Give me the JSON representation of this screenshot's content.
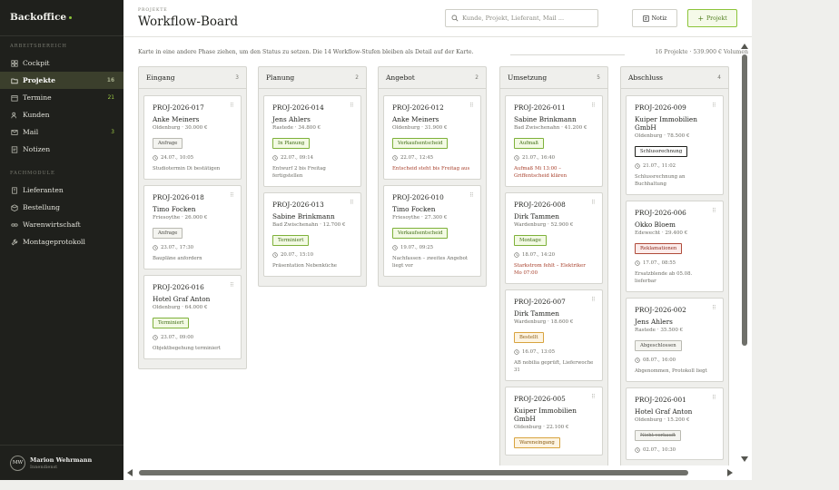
{
  "brand": "Backoffice",
  "sidebar": {
    "section_work": "ARBEITSBEREICH",
    "section_modules": "FACHMODULE",
    "work_items": [
      {
        "label": "Cockpit",
        "icon": "grid-icon",
        "badge": ""
      },
      {
        "label": "Projekte",
        "icon": "folder-icon",
        "badge": "16"
      },
      {
        "label": "Termine",
        "icon": "calendar-icon",
        "badge": "21"
      },
      {
        "label": "Kunden",
        "icon": "users-icon",
        "badge": ""
      },
      {
        "label": "Mail",
        "icon": "mail-icon",
        "badge": "3"
      },
      {
        "label": "Notizen",
        "icon": "note-icon",
        "badge": ""
      }
    ],
    "module_items": [
      {
        "label": "Lieferanten",
        "icon": "building-icon"
      },
      {
        "label": "Bestellung",
        "icon": "package-icon"
      },
      {
        "label": "Warenwirtschaft",
        "icon": "link-icon"
      },
      {
        "label": "Montageprotokoll",
        "icon": "wrench-icon"
      }
    ]
  },
  "user": {
    "initials": "MW",
    "name": "Marion Wehrmann",
    "role": "Innendienst"
  },
  "header": {
    "eyebrow": "PROJEKTE",
    "title": "Workflow-Board",
    "search_placeholder": "Kunde, Projekt, Lieferant, Mail ...",
    "note_button": "Notiz",
    "project_button": "Projekt"
  },
  "hint": "Karte in eine andere Phase ziehen, um den Status zu setzen. Die 14 Workflow-Stufen bleiben als Detail auf der Karte.",
  "stats": "16 Projekte · 539.900 € Volumen",
  "columns": [
    {
      "title": "Eingang",
      "count": "3",
      "cards": [
        {
          "id": "PROJ-2026-017",
          "name": "Anke Meiners",
          "meta": "Oldenburg · 30.000 €",
          "tag": "Anfrage",
          "tag_style": "gray",
          "time": "24.07., 10:05",
          "note": "Studiotermin Di bestätigen",
          "alert": false
        },
        {
          "id": "PROJ-2026-018",
          "name": "Timo Focken",
          "meta": "Friesoythe · 26.000 €",
          "tag": "Anfrage",
          "tag_style": "gray",
          "time": "23.07., 17:30",
          "note": "Baupläne anfordern",
          "alert": false
        },
        {
          "id": "PROJ-2026-016",
          "name": "Hotel Graf Anton",
          "meta": "Oldenburg · 64.000 €",
          "tag": "Terminiert",
          "tag_style": "green",
          "time": "23.07., 09:00",
          "note": "Objektbegehung terminiert",
          "alert": false
        }
      ]
    },
    {
      "title": "Planung",
      "count": "2",
      "cards": [
        {
          "id": "PROJ-2026-014",
          "name": "Jens Ahlers",
          "meta": "Rastede · 34.800 €",
          "tag": "In Planung",
          "tag_style": "green",
          "time": "22.07., 09:14",
          "note": "Entwurf 2 bis Freitag fertigstellen",
          "alert": false
        },
        {
          "id": "PROJ-2026-013",
          "name": "Sabine Brinkmann",
          "meta": "Bad Zwischenahn · 12.700 €",
          "tag": "Terminiert",
          "tag_style": "green",
          "time": "20.07., 15:10",
          "note": "Präsentation Nebenküche",
          "alert": false
        }
      ]
    },
    {
      "title": "Angebot",
      "count": "2",
      "cards": [
        {
          "id": "PROJ-2026-012",
          "name": "Anke Meiners",
          "meta": "Oldenburg · 31.900 €",
          "tag": "Verkaufsentscheid",
          "tag_style": "green",
          "time": "22.07., 12:45",
          "note": "Entscheid steht bis Freitag aus",
          "alert": true
        },
        {
          "id": "PROJ-2026-010",
          "name": "Timo Focken",
          "meta": "Friesoythe · 27.300 €",
          "tag": "Verkaufsentscheid",
          "tag_style": "green",
          "time": "19.07., 09:25",
          "note": "Nachfassen – zweites Angebot liegt vor",
          "alert": false
        }
      ]
    },
    {
      "title": "Umsetzung",
      "count": "5",
      "cards": [
        {
          "id": "PROJ-2026-011",
          "name": "Sabine Brinkmann",
          "meta": "Bad Zwischenahn · 41.200 €",
          "tag": "Aufmaß",
          "tag_style": "green",
          "time": "21.07., 16:40",
          "note": "Aufmaß Mi 13:00 – Griffentscheid klären",
          "alert": true
        },
        {
          "id": "PROJ-2026-008",
          "name": "Dirk Tammen",
          "meta": "Wardenburg · 52.900 €",
          "tag": "Montage",
          "tag_style": "green",
          "time": "18.07., 14:20",
          "note": "Starkstrom fehlt – Elektriker Mo 07:00",
          "alert": true
        },
        {
          "id": "PROJ-2026-007",
          "name": "Dirk Tammen",
          "meta": "Wardenburg · 18.600 €",
          "tag": "Bestellt",
          "tag_style": "amber",
          "time": "16.07., 13:05",
          "note": "AB nobilia geprüft, Lieferwoche 31",
          "alert": false
        },
        {
          "id": "PROJ-2026-005",
          "name": "Kuiper Immobilien GmbH",
          "meta": "Oldenburg · 22.100 €",
          "tag": "Wareneingang",
          "tag_style": "amber",
          "time": "",
          "note": "",
          "alert": false
        }
      ]
    },
    {
      "title": "Abschluss",
      "count": "4",
      "cards": [
        {
          "id": "PROJ-2026-009",
          "name": "Kuiper Immobilien GmbH",
          "meta": "Oldenburg · 78.500 €",
          "tag": "Schlussrechnung",
          "tag_style": "dark",
          "time": "21.07., 11:02",
          "note": "Schlussrechnung an Buchhaltung",
          "alert": false
        },
        {
          "id": "PROJ-2026-006",
          "name": "Okko Bloem",
          "meta": "Edewecht · 29.400 €",
          "tag": "Reklamationen",
          "tag_style": "red",
          "time": "17.07., 08:55",
          "note": "Ersatzblende ab 05.08. lieferbar",
          "alert": false
        },
        {
          "id": "PROJ-2026-002",
          "name": "Jens Ahlers",
          "meta": "Rastede · 35.500 €",
          "tag": "Abgeschlossen",
          "tag_style": "gray",
          "time": "08.07., 16:00",
          "note": "Abgenommen, Protokoll liegt",
          "alert": false
        },
        {
          "id": "PROJ-2026-001",
          "name": "Hotel Graf Anton",
          "meta": "Oldenburg · 15.200 €",
          "tag": "Nicht verkauft",
          "tag_style": "strike",
          "time": "02.07., 10:30",
          "note": "",
          "alert": false
        }
      ]
    }
  ]
}
